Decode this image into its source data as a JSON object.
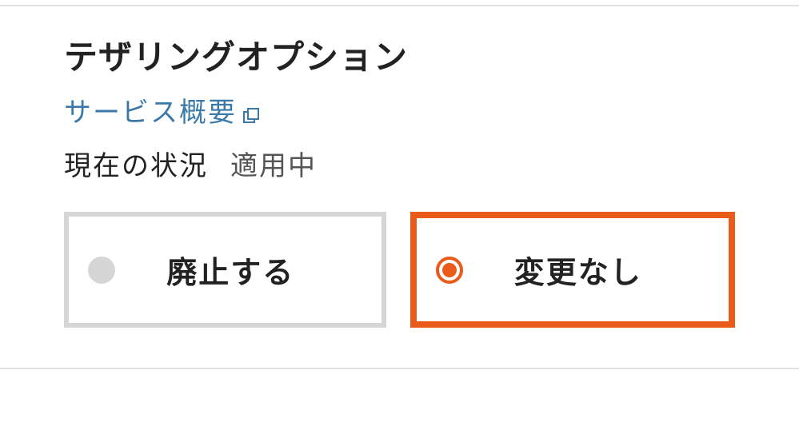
{
  "section": {
    "title": "テザリングオプション",
    "service_link_label": "サービス概要",
    "status_label": "現在の状況",
    "status_value": "適用中"
  },
  "options": {
    "cancel_label": "廃止する",
    "nochange_label": "変更なし"
  },
  "colors": {
    "accent": "#ea5a19",
    "link": "#3b7aa8",
    "border_inactive": "#d6d6d6"
  }
}
